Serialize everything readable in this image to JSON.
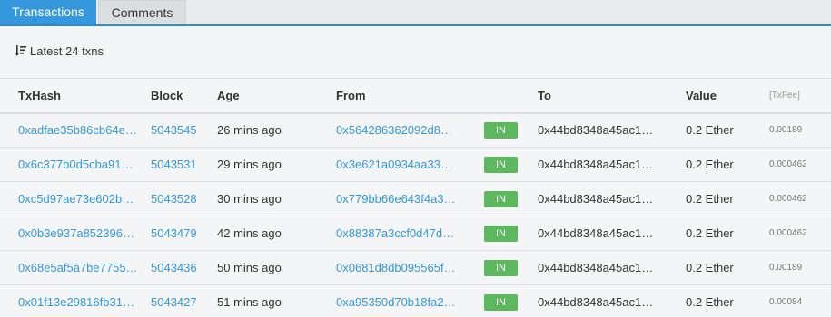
{
  "tabs": [
    {
      "label": "Transactions",
      "active": true
    },
    {
      "label": "Comments",
      "active": false
    }
  ],
  "summary": "Latest 24 txns",
  "columns": {
    "txhash": "TxHash",
    "block": "Block",
    "age": "Age",
    "from": "From",
    "to": "To",
    "value": "Value",
    "txfee": "[TxFee]"
  },
  "rows": [
    {
      "hash": "0xadfae35b86cb64e…",
      "block": "5043545",
      "age": "26 mins ago",
      "from": "0x564286362092d8…",
      "dir": "IN",
      "to": "0x44bd8348a45ac1…",
      "value": "0.2 Ether",
      "fee": "0.00189"
    },
    {
      "hash": "0x6c377b0d5cba91…",
      "block": "5043531",
      "age": "29 mins ago",
      "from": "0x3e621a0934aa33…",
      "dir": "IN",
      "to": "0x44bd8348a45ac1…",
      "value": "0.2 Ether",
      "fee": "0.000462"
    },
    {
      "hash": "0xc5d97ae73e602b…",
      "block": "5043528",
      "age": "30 mins ago",
      "from": "0x779bb66e643f4a3…",
      "dir": "IN",
      "to": "0x44bd8348a45ac1…",
      "value": "0.2 Ether",
      "fee": "0.000462"
    },
    {
      "hash": "0x0b3e937a852396…",
      "block": "5043479",
      "age": "42 mins ago",
      "from": "0x88387a3ccf0d47d…",
      "dir": "IN",
      "to": "0x44bd8348a45ac1…",
      "value": "0.2 Ether",
      "fee": "0.000462"
    },
    {
      "hash": "0x68e5af5a7be7755…",
      "block": "5043436",
      "age": "50 mins ago",
      "from": "0x0681d8db095565f…",
      "dir": "IN",
      "to": "0x44bd8348a45ac1…",
      "value": "0.2 Ether",
      "fee": "0.00189"
    },
    {
      "hash": "0x01f13e29816fb31…",
      "block": "5043427",
      "age": "51 mins ago",
      "from": "0xa95350d70b18fa2…",
      "dir": "IN",
      "to": "0x44bd8348a45ac1…",
      "value": "0.2 Ether",
      "fee": "0.00084"
    }
  ],
  "colors": {
    "accent": "#3598dc",
    "badge_in": "#5cb85c"
  },
  "icons": {
    "sort": "sort-descending-icon"
  }
}
